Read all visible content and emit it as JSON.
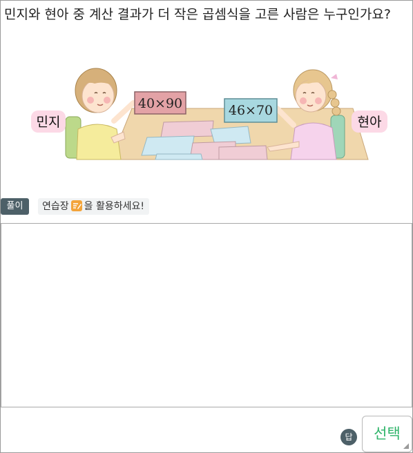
{
  "question": "민지와 현아 중 계산 결과가 더 작은 곱셈식을 고른 사람은 누구인가요?",
  "illustration": {
    "left_name": "민지",
    "right_name": "현아",
    "left_card": "40×90",
    "right_card": "46×70"
  },
  "solution": {
    "badge": "풀이",
    "hint_before": "연습장",
    "hint_after": "을 활용하세요!"
  },
  "answer": {
    "badge": "답",
    "select_label": "선택"
  },
  "colors": {
    "badge_bg": "#4d6068",
    "select_text": "#2fb46a",
    "name_tag": "#fcd9e6",
    "left_card": "#e3a2a6",
    "right_card": "#a8d8e0",
    "pad_icon": "#f3a43a"
  },
  "icons": [
    "notepad-icon",
    "resize-corner-icon"
  ]
}
